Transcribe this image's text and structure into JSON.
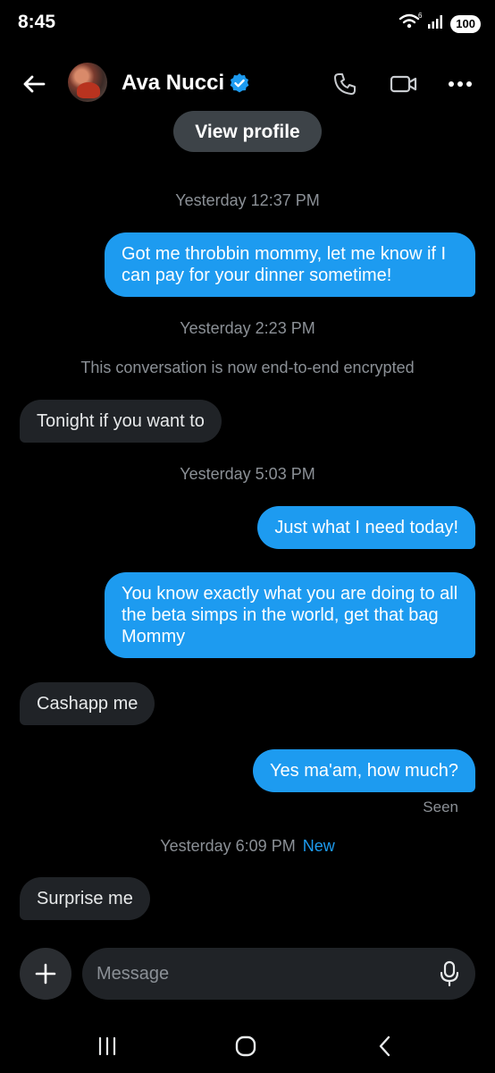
{
  "status_bar": {
    "time": "8:45",
    "battery": "100",
    "network": "6"
  },
  "header": {
    "contact_name": "Ava Nucci"
  },
  "view_profile_label": "View profile",
  "timestamps": {
    "t1": "Yesterday 12:37 PM",
    "t2": "Yesterday 2:23 PM",
    "t3": "Yesterday 5:03 PM",
    "t4": "Yesterday 6:09 PM",
    "t4_badge": "New"
  },
  "system_note": "This conversation is now end-to-end encrypted",
  "messages": [
    {
      "direction": "outgoing",
      "text": "Got me throbbin mommy, let me know if I can pay for your dinner sometime!"
    },
    {
      "direction": "incoming",
      "text": "Tonight if you want to"
    },
    {
      "direction": "outgoing",
      "text": "Just what I need today!"
    },
    {
      "direction": "outgoing",
      "text": "You know exactly what you are doing to all the beta simps in the world, get that bag Mommy"
    },
    {
      "direction": "incoming",
      "text": "Cashapp me"
    },
    {
      "direction": "outgoing",
      "text": "Yes ma'am, how much?"
    },
    {
      "direction": "incoming",
      "text": "Surprise me"
    }
  ],
  "seen_label": "Seen",
  "composer": {
    "placeholder": "Message"
  },
  "icons": {
    "back": "arrow-left-icon",
    "verified": "verified-badge-icon",
    "phone": "phone-icon",
    "video": "video-camera-icon",
    "more": "more-dots-icon",
    "add": "plus-icon",
    "mic": "microphone-icon",
    "nav_recents": "recents-icon",
    "nav_home": "home-icon",
    "nav_back": "chevron-left-icon"
  },
  "colors": {
    "accent": "#1d9bf0",
    "background": "#000000",
    "incoming_bubble": "#202327",
    "muted_text": "#8b9096"
  }
}
